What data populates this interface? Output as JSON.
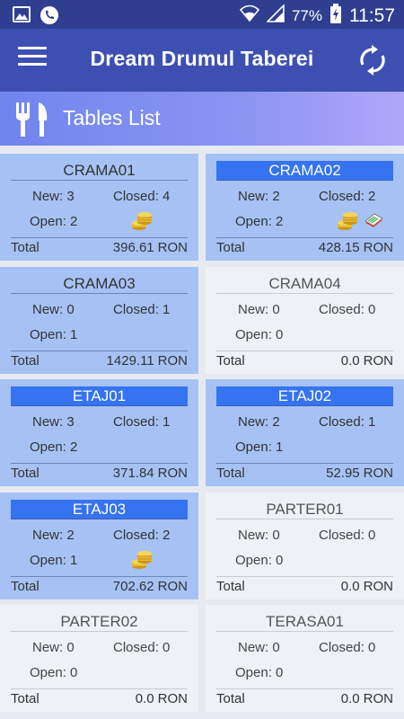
{
  "status_bar": {
    "battery_percent": "77%",
    "time": "11:57"
  },
  "app_bar": {
    "title": "Dream Drumul Taberei"
  },
  "sub_header": {
    "title": "Tables List"
  },
  "tables": [
    {
      "name": "CRAMA01",
      "highlighted": false,
      "new_label": "New: 3",
      "closed_label": "Closed: 4",
      "open_label": "Open: 2",
      "coins": true,
      "receipt": false,
      "total_label": "Total",
      "total_value": "396.61",
      "currency": "RON",
      "empty": false
    },
    {
      "name": "CRAMA02",
      "highlighted": true,
      "new_label": "New: 2",
      "closed_label": "Closed: 2",
      "open_label": "Open: 2",
      "coins": true,
      "receipt": true,
      "total_label": "Total",
      "total_value": "428.15",
      "currency": "RON",
      "empty": false
    },
    {
      "name": "CRAMA03",
      "highlighted": false,
      "new_label": "New: 0",
      "closed_label": "Closed: 1",
      "open_label": "Open: 1",
      "coins": false,
      "receipt": false,
      "total_label": "Total",
      "total_value": "1429.11",
      "currency": "RON",
      "empty": false
    },
    {
      "name": "CRAMA04",
      "highlighted": false,
      "new_label": "New: 0",
      "closed_label": "Closed: 0",
      "open_label": "Open: 0",
      "coins": false,
      "receipt": false,
      "total_label": "Total",
      "total_value": "0.0",
      "currency": "RON",
      "empty": true
    },
    {
      "name": "ETAJ01",
      "highlighted": true,
      "new_label": "New: 3",
      "closed_label": "Closed: 1",
      "open_label": "Open: 2",
      "coins": false,
      "receipt": false,
      "total_label": "Total",
      "total_value": "371.84",
      "currency": "RON",
      "empty": false
    },
    {
      "name": "ETAJ02",
      "highlighted": true,
      "new_label": "New: 2",
      "closed_label": "Closed: 1",
      "open_label": "Open: 1",
      "coins": false,
      "receipt": false,
      "total_label": "Total",
      "total_value": "52.95",
      "currency": "RON",
      "empty": false
    },
    {
      "name": "ETAJ03",
      "highlighted": true,
      "new_label": "New: 2",
      "closed_label": "Closed: 2",
      "open_label": "Open: 1",
      "coins": true,
      "receipt": false,
      "total_label": "Total",
      "total_value": "702.62",
      "currency": "RON",
      "empty": false
    },
    {
      "name": "PARTER01",
      "highlighted": false,
      "new_label": "New: 0",
      "closed_label": "Closed: 0",
      "open_label": "Open: 0",
      "coins": false,
      "receipt": false,
      "total_label": "Total",
      "total_value": "0.0",
      "currency": "RON",
      "empty": true
    },
    {
      "name": "PARTER02",
      "highlighted": false,
      "new_label": "New: 0",
      "closed_label": "Closed: 0",
      "open_label": "Open: 0",
      "coins": false,
      "receipt": false,
      "total_label": "Total",
      "total_value": "0.0",
      "currency": "RON",
      "empty": true
    },
    {
      "name": "TERASA01",
      "highlighted": false,
      "new_label": "New: 0",
      "closed_label": "Closed: 0",
      "open_label": "Open: 0",
      "coins": false,
      "receipt": false,
      "total_label": "Total",
      "total_value": "0.0",
      "currency": "RON",
      "empty": true
    }
  ]
}
